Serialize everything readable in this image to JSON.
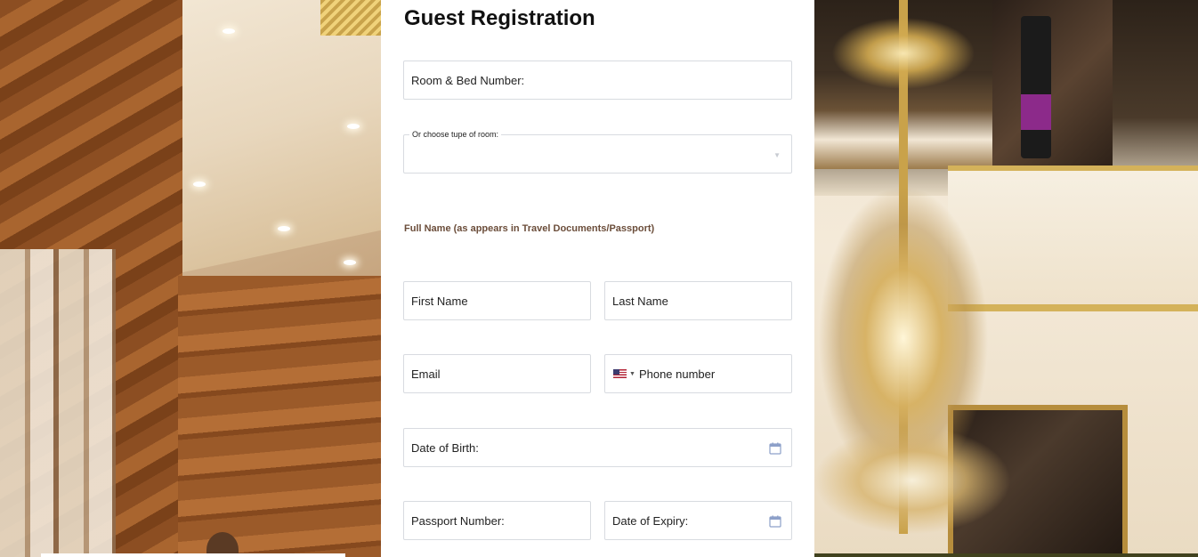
{
  "form": {
    "title": "Guest Registration",
    "room_bed_label": "Room & Bed Number:",
    "room_type_label": "Or choose tupe of room:",
    "room_type_value": "",
    "full_name_section": "Full Name (as appears in Travel Documents/Passport)",
    "first_name_placeholder": "First Name",
    "last_name_placeholder": "Last Name",
    "email_placeholder": "Email",
    "phone_placeholder": "Phone number",
    "phone_country": "us-flag-icon",
    "dob_label": "Date of Birth:",
    "passport_label": "Passport Number:",
    "expiry_label": "Date of Expiry:"
  },
  "colors": {
    "section_label": "#6b4d3a",
    "field_border": "#d8dbe0",
    "calendar_icon": "#8da0c9"
  }
}
